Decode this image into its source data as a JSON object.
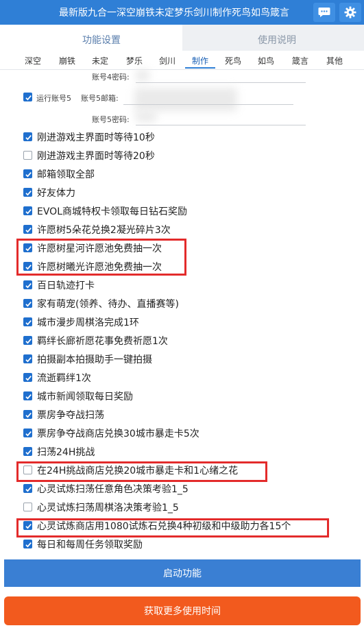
{
  "title_bar": {
    "title": "最新版九合一深空崩铁未定梦乐剑川制作死鸟如鸟箴言",
    "chat_icon": "chat-bubble-icon",
    "settings_icon": "gear-icon",
    "bg_color": "#2f7fd6"
  },
  "main_tabs": [
    {
      "label": "功能设置",
      "active": true
    },
    {
      "label": "使用说明",
      "active": false
    }
  ],
  "sub_tabs": [
    {
      "label": "深空"
    },
    {
      "label": "崩铁"
    },
    {
      "label": "未定"
    },
    {
      "label": "梦乐"
    },
    {
      "label": "剑川"
    },
    {
      "label": "制作",
      "active": true
    },
    {
      "label": "死鸟"
    },
    {
      "label": "如鸟"
    },
    {
      "label": "箴言"
    },
    {
      "label": "其他"
    }
  ],
  "accounts": {
    "acc4_password_label": "账号4密码:",
    "run_acc5_label": "运行账号5",
    "run_acc5_checked": true,
    "acc5_email_label": "账号5邮箱:",
    "acc5_password_label": "账号5密码:"
  },
  "options": [
    {
      "label": "刚进游戏主界面时等待10秒",
      "checked": true
    },
    {
      "label": "刚进游戏主界面时等待20秒",
      "checked": false
    },
    {
      "label": "邮箱领取全部",
      "checked": true
    },
    {
      "label": "好友体力",
      "checked": true
    },
    {
      "label": "EVOL商城特权卡领取每日钻石奖励",
      "checked": true
    },
    {
      "label": "许愿树5朵花兑换2凝光碎片3次",
      "checked": true
    },
    {
      "label": "许愿树星河许愿池免费抽一次",
      "checked": true
    },
    {
      "label": "许愿树曦光许愿池免费抽一次",
      "checked": true
    },
    {
      "label": "百日轨迹打卡",
      "checked": true
    },
    {
      "label": "家有萌宠(领养、待办、直播赛等)",
      "checked": true
    },
    {
      "label": "城市漫步周棋洛完成1环",
      "checked": true
    },
    {
      "label": "羁绊长廊祈愿花事免费祈愿1次",
      "checked": true
    },
    {
      "label": "拍摄副本拍摄助手一键拍摄",
      "checked": true
    },
    {
      "label": "流逝羁绊1次",
      "checked": true
    },
    {
      "label": "城市新闻领取每日奖励",
      "checked": true
    },
    {
      "label": "票房争夺战扫荡",
      "checked": true
    },
    {
      "label": "票房争夺战商店兑换30城市暴走卡5次",
      "checked": true
    },
    {
      "label": "扫荡24H挑战",
      "checked": true
    },
    {
      "label": "在24H挑战商店兑换20城市暴走卡和1心绪之花",
      "checked": false
    },
    {
      "label": "心灵试炼扫荡任意角色决策考验1_5",
      "checked": true
    },
    {
      "label": "心灵试炼扫荡周棋洛决策考验1_5",
      "checked": false
    },
    {
      "label": "心灵试炼商店用1080试炼石兑换4种初级和中级助力各15个",
      "checked": true
    },
    {
      "label": "每日和每周任务领取奖励",
      "checked": true
    }
  ],
  "buttons": {
    "start": "启动功能",
    "more_time": "获取更多使用时间"
  },
  "colors": {
    "accent": "#2f7fd6",
    "checkbox": "#1f6fce",
    "highlight": "#e32b2b",
    "more_button": "#f25a1e"
  }
}
